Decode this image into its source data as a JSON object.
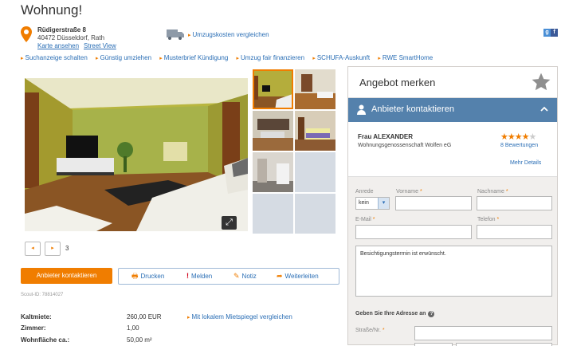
{
  "page": {
    "title": "Wohnung!"
  },
  "address": {
    "street": "Rüdigerstraße 8",
    "city": "40472 Düsseldorf, Rath",
    "map_link": "Karte ansehen",
    "streetview_link": "Street View"
  },
  "moving": {
    "link": "Umzugskosten vergleichen"
  },
  "nav_links": [
    "Suchanzeige schalten",
    "Günstig umziehen",
    "Musterbrief Kündigung",
    "Umzug fair finanzieren",
    "SCHUFA-Auskunft",
    "RWE SmartHome"
  ],
  "gallery": {
    "page_count": "3"
  },
  "actions": {
    "contact_button": "Anbieter kontaktieren",
    "print": "Drucken",
    "report": "Melden",
    "note": "Notiz",
    "forward": "Weiterleiten"
  },
  "scout_id": "Scout-ID: 78814027",
  "facts": {
    "rows": [
      {
        "label": "Kaltmiete:",
        "value": "260,00 EUR"
      },
      {
        "label": "Zimmer:",
        "value": "1,00"
      },
      {
        "label": "Wohnfläche ca.:",
        "value": "50,00 m²"
      }
    ],
    "mietspiegel_link": "Mit lokalem Mietspiegel vergleichen"
  },
  "sidebar": {
    "merken": "Angebot merken",
    "kontakt_header": "Anbieter kontaktieren",
    "provider_name": "Frau ALEXANDER",
    "provider_company": "Wohnungsgenossenschaft Wolfen eG",
    "rating_stars": 4,
    "rating_max": 5,
    "ratings_count": "8 Bewertungen",
    "details_link": "Mehr Details"
  },
  "form": {
    "anrede_label": "Anrede",
    "anrede_value": "kein",
    "vorname_label": "Vorname",
    "nachname_label": "Nachname",
    "email_label": "E-Mail",
    "telefon_label": "Telefon",
    "message": "Besichtigungstermin ist erwünscht.",
    "address_heading": "Geben Sie Ihre Adresse an",
    "street_label": "Straße/Nr."
  },
  "colors": {
    "accent_orange": "#f07d00",
    "link_blue": "#2a6eb5",
    "contact_bar": "#5481ac"
  }
}
